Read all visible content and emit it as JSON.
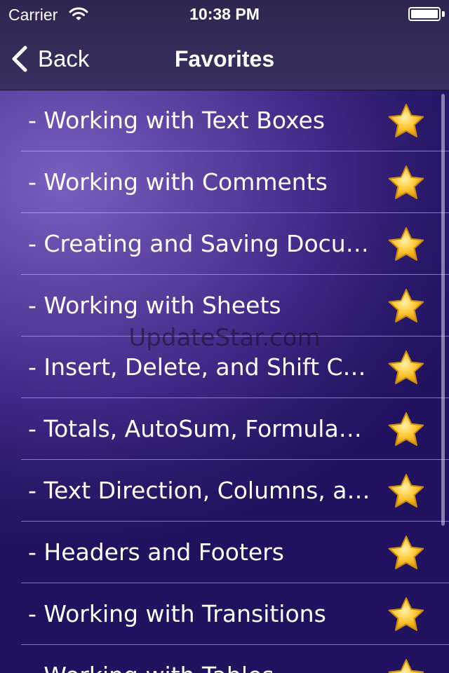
{
  "status_bar": {
    "carrier": "Carrier",
    "time": "10:38 PM",
    "wifi_icon": "wifi-icon",
    "battery_icon": "battery-icon",
    "battery_level": 1.0
  },
  "nav": {
    "back_label": "Back",
    "back_icon": "chevron-left-icon",
    "title": "Favorites"
  },
  "favorites": [
    {
      "label": "- Working with Text Boxes",
      "icon": "star-icon"
    },
    {
      "label": "- Working with Comments",
      "icon": "star-icon"
    },
    {
      "label": "- Creating and Saving Documents",
      "icon": "star-icon"
    },
    {
      "label": "- Working with Sheets",
      "icon": "star-icon"
    },
    {
      "label": "- Insert, Delete, and Shift Cells",
      "icon": "star-icon"
    },
    {
      "label": "- Totals, AutoSum, Formulas, and Functions",
      "icon": "star-icon"
    },
    {
      "label": "- Text Direction, Columns, and Sections",
      "icon": "star-icon"
    },
    {
      "label": "- Headers and Footers",
      "icon": "star-icon"
    },
    {
      "label": "- Working with Transitions",
      "icon": "star-icon"
    },
    {
      "label": "- Working with Tables",
      "icon": "star-icon"
    }
  ],
  "watermark": "UpdateStar.com",
  "colors": {
    "star_fill": "#fcc733",
    "star_stroke": "#c98a10",
    "background_top": "#7a5fc0",
    "background_bottom": "#211260"
  }
}
